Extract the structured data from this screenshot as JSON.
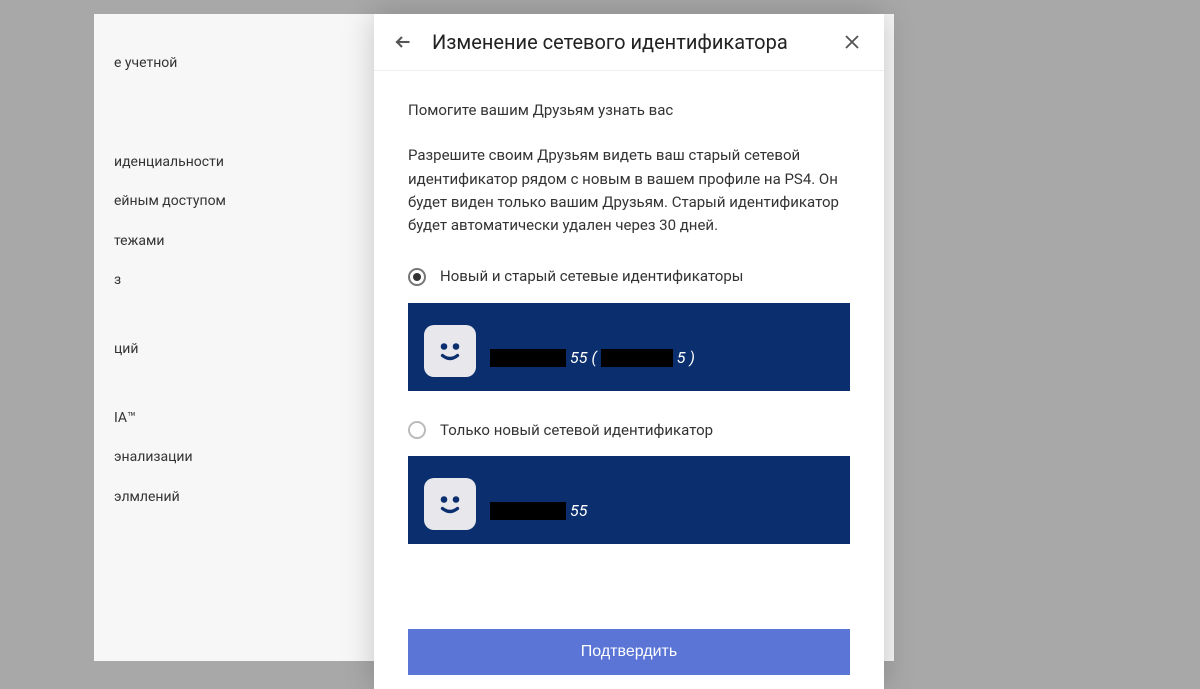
{
  "background_sidebar": {
    "items": [
      "е учетной",
      "",
      "иденциальности",
      "ейным доступом",
      "тежами",
      "з",
      "ций",
      "IA™",
      "энализации",
      "элмлений"
    ]
  },
  "modal": {
    "title": "Изменение сетевого идентификатора",
    "heading": "Помогите вашим Друзьям узнать вас",
    "description": "Разрешите своим Друзьям видеть ваш старый сетевой идентификатор рядом с новым в вашем профиле на PS4. Он будет виден только вашим Друзьям. Старый идентификатор будет автоматически удален через 30 дней.",
    "option1": {
      "label": "Новый и старый сетевые идентификаторы",
      "id_suffix": "55",
      "old_suffix": "5",
      "open_paren": "(",
      "close_paren": ")"
    },
    "option2": {
      "label": "Только новый сетевой идентификатор",
      "id_suffix": "55"
    },
    "confirm_label": "Подтвердить"
  }
}
